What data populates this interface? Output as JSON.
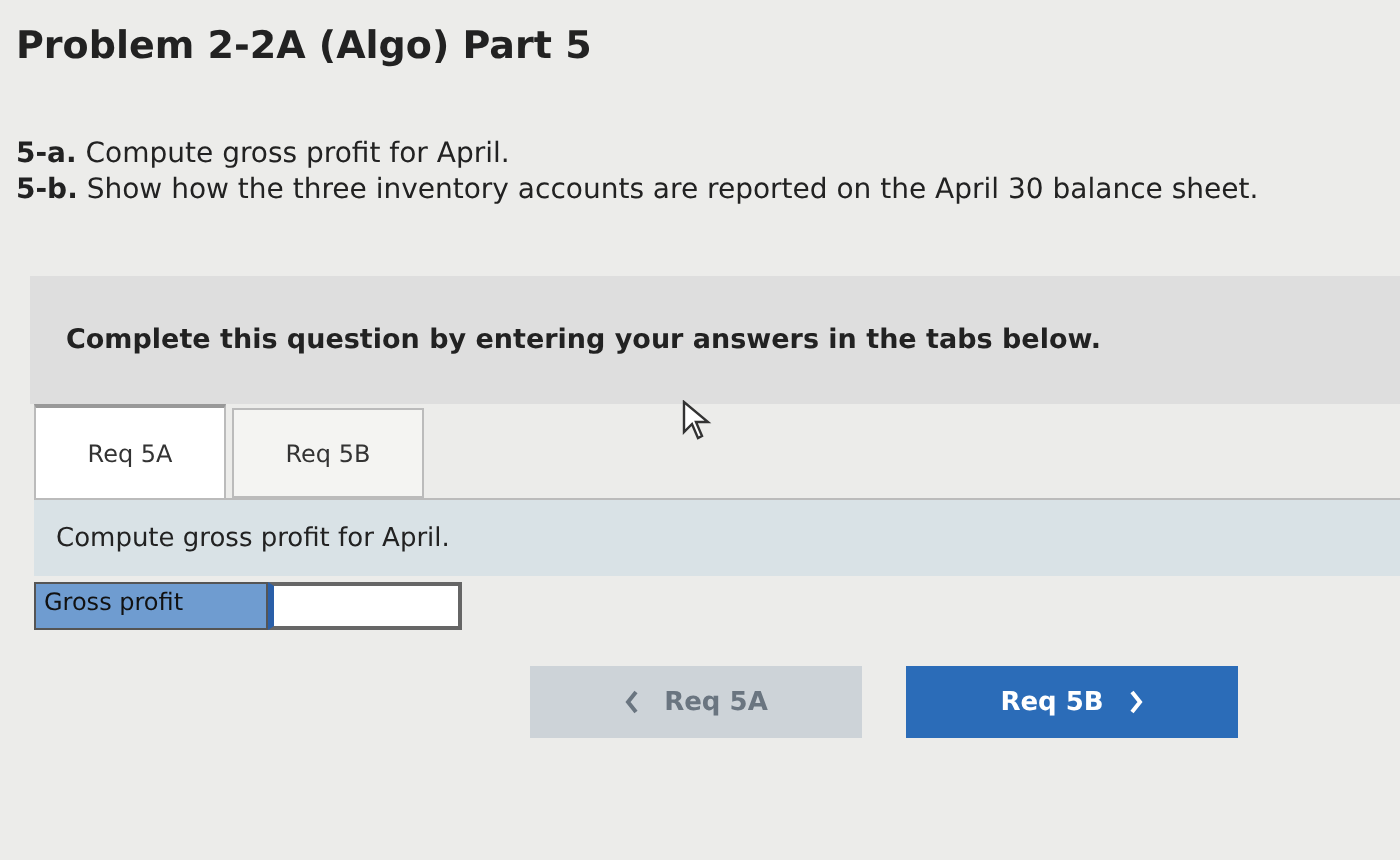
{
  "title": "Problem 2-2A (Algo) Part 5",
  "requirements": [
    {
      "label": "5-a.",
      "text": "Compute gross profit for April."
    },
    {
      "label": "5-b.",
      "text": "Show how the three inventory accounts are reported on the April 30 balance sheet."
    }
  ],
  "instruction": "Complete this question by entering your answers in the tabs below.",
  "tabs": [
    {
      "label": "Req 5A",
      "selected": true
    },
    {
      "label": "Req 5B",
      "selected": false
    }
  ],
  "panel": {
    "prompt": "Compute gross profit for April.",
    "rows": [
      {
        "label": "Gross profit"
      }
    ]
  },
  "nav": [
    {
      "kind": "prev",
      "label": "Req 5A",
      "disabled": true
    },
    {
      "kind": "next",
      "label": "Req 5B",
      "disabled": false
    }
  ]
}
